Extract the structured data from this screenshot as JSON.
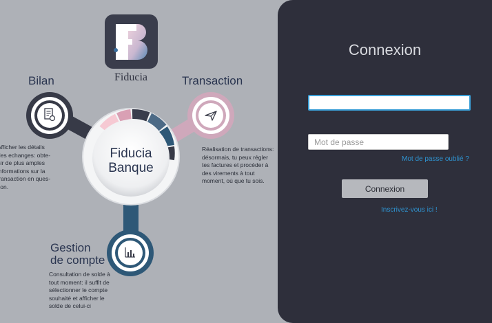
{
  "brand": {
    "logo_caption": "Fiducia",
    "center_line1": "Fiducia",
    "center_line2": "Banque"
  },
  "features": {
    "bilan": {
      "title": "Bilan",
      "description": "Afficher les détails\ndes echanges:  obte-\nnir de plus amples\ninformations sur la\ntransaction en ques-\ntion."
    },
    "transaction": {
      "title": "Transaction",
      "description": "Réalisation de transactions:\ndésormais, tu peux régler\ntes factures et procéder à\ndes virements à tout\nmoment, où que tu sois."
    },
    "gestion": {
      "title_line1": "Gestion",
      "title_line2": "de compte",
      "description": "Consultation de solde à\ntout moment: il suffit de\nsélectionner le compte\nsouhaité et afficher le\nsolde de celui-ci"
    }
  },
  "login": {
    "title": "Connexion",
    "username_value": "",
    "password_placeholder": "Mot de passe",
    "forgot_link": "Mot de passe oublié ?",
    "submit_label": "Connexion",
    "register_link": "Inscrivez-vous ici !"
  },
  "colors": {
    "background": "#aeb1b7",
    "panel": "#2e2f3b",
    "accent_blue": "#2e93d0",
    "teal_blue": "#2e5877",
    "dark_slate": "#3a3d4c",
    "pink": "#d9a0b4"
  }
}
